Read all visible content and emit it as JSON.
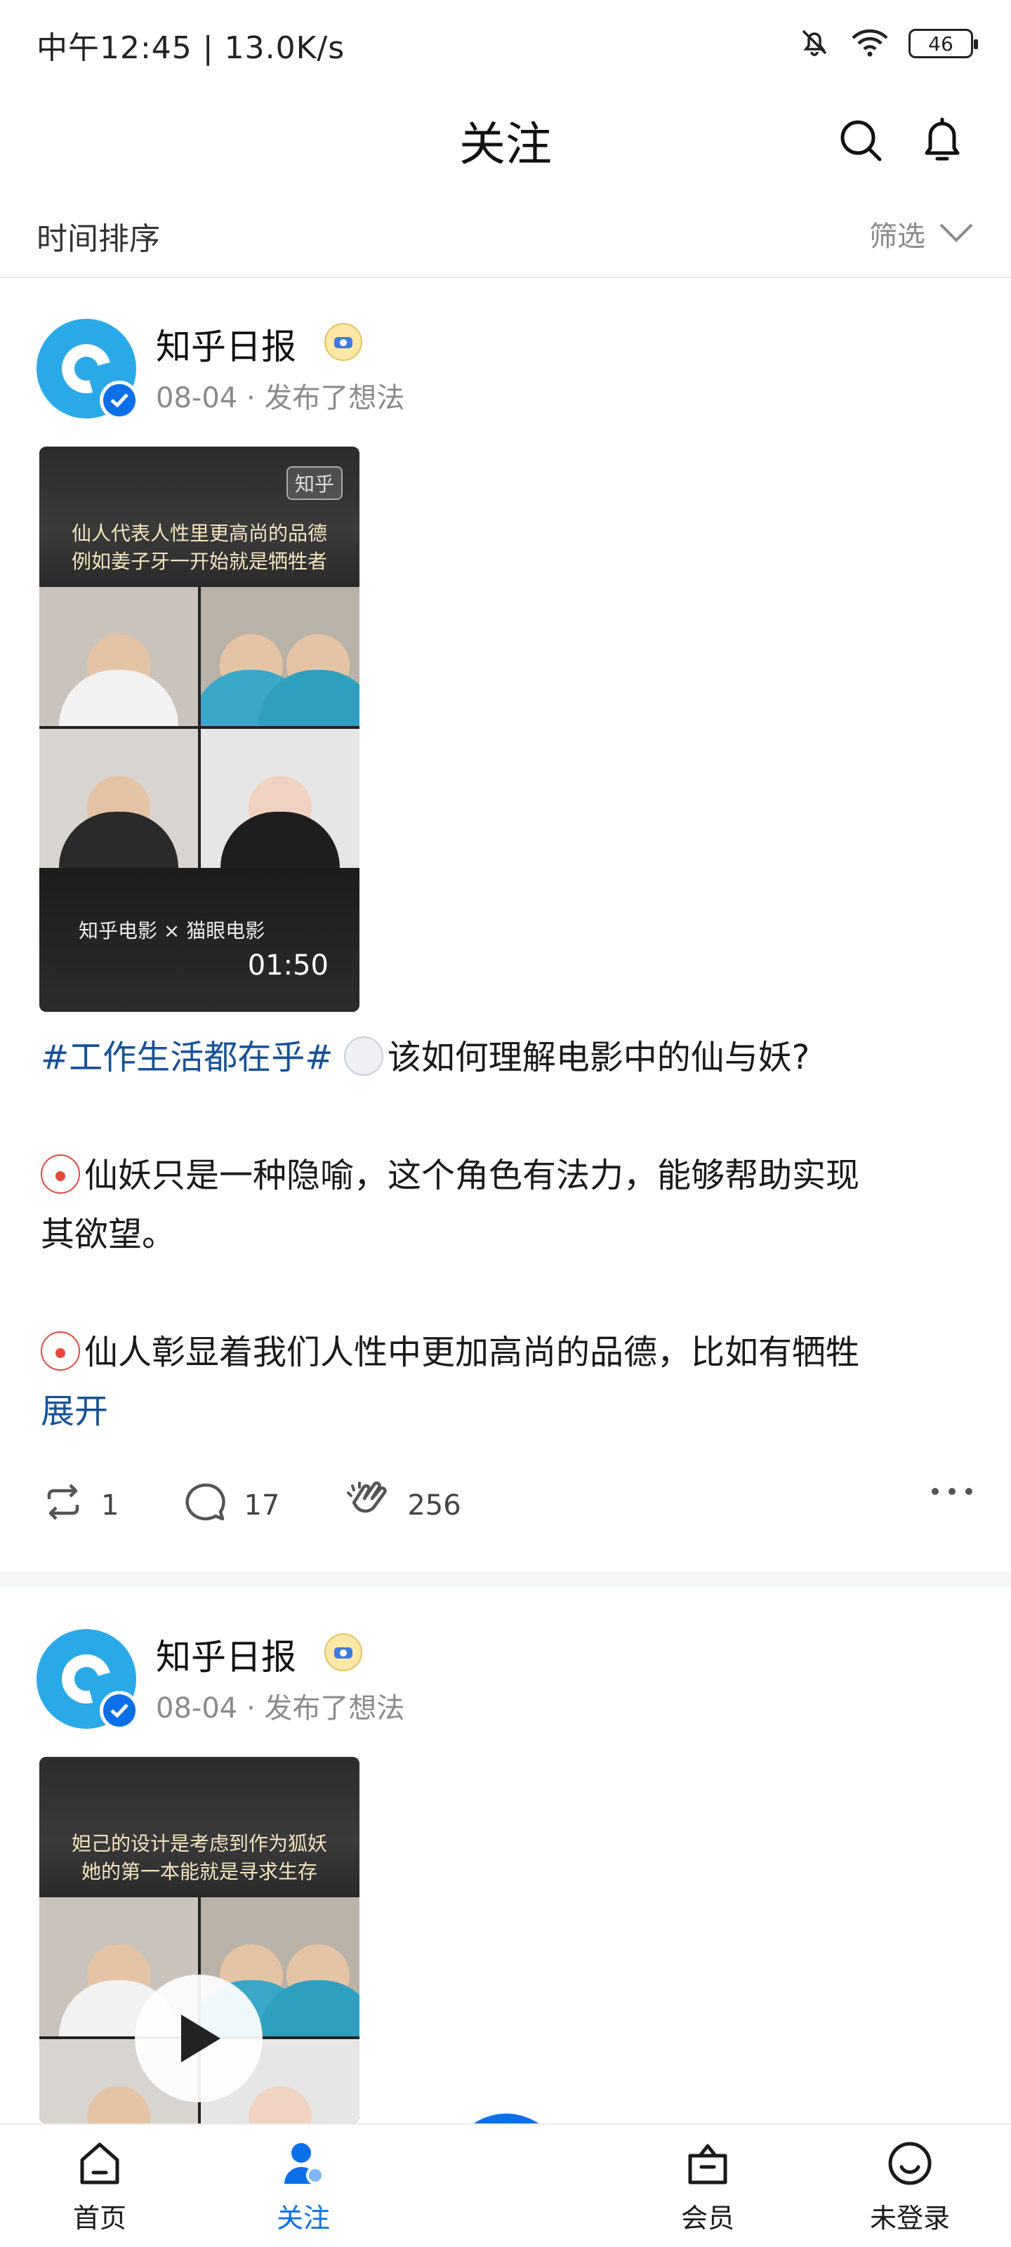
{
  "status_bar": {
    "time_speed": "中午12:45 | 13.0K/s",
    "battery": "46"
  },
  "header": {
    "title": "关注"
  },
  "sort_bar": {
    "sort_label": "时间排序",
    "filter_label": "筛选"
  },
  "feed": [
    {
      "author": "知乎日报",
      "date": "08-04",
      "action": "发布了想法",
      "video": {
        "logo": "知乎",
        "caption_line1": "仙人代表人性里更高尚的品德",
        "caption_line2": "例如姜子牙一开始就是牺牲者",
        "brands": "知乎电影 × 猫眼电影",
        "duration": "01:50"
      },
      "topic": "#工作生活都在乎#",
      "line1": "该如何理解电影中的仙与妖?",
      "line2": "仙妖只是一种隐喻，这个角色有法力，能够帮助实现",
      "line3": "其欲望。",
      "line4": "仙人彰显着我们人性中更加高尚的品德，比如有牺牲",
      "expand": "展开",
      "reposts": "1",
      "comments": "17",
      "claps": "256"
    },
    {
      "author": "知乎日报",
      "date": "08-04",
      "action": "发布了想法",
      "video": {
        "caption_line1": "妲己的设计是考虑到作为狐妖",
        "caption_line2": "她的第一本能就是寻求生存"
      }
    }
  ],
  "bottom_nav": {
    "items": [
      {
        "label": "首页"
      },
      {
        "label": "关注"
      },
      {
        "label": "会员"
      },
      {
        "label": "未登录"
      }
    ],
    "active_color": "#0a6fe8"
  }
}
